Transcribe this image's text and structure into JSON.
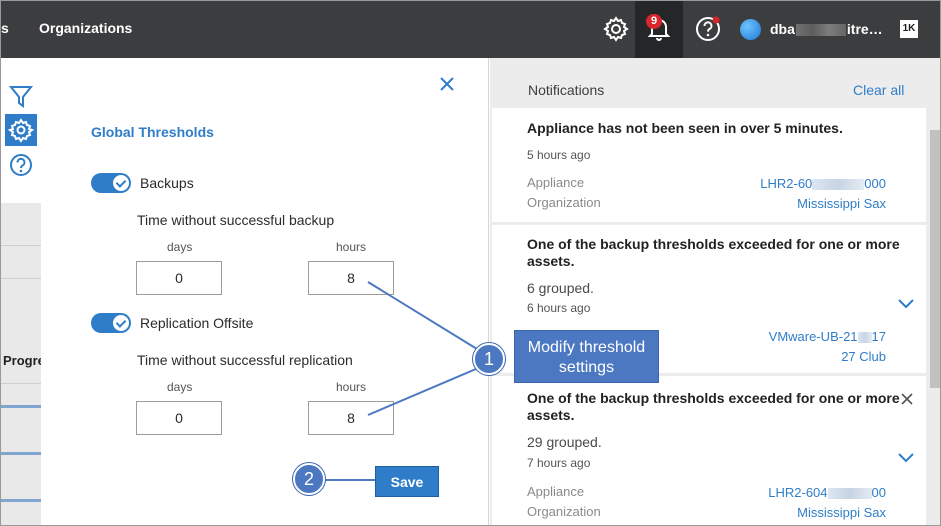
{
  "topbar": {
    "partial_nav": "s",
    "nav_item": "Organizations",
    "notification_badge": "9",
    "user_name_start": "dba",
    "user_name_end": "itre…",
    "logo_text": "1K"
  },
  "left_rail": {
    "partial_column_header": "Progre"
  },
  "global_thresholds": {
    "title": "Global Thresholds",
    "backups": {
      "toggle_label": "Backups",
      "enabled": true,
      "subtitle": "Time without successful backup",
      "days_label": "days",
      "hours_label": "hours",
      "days_value": "0",
      "hours_value": "8"
    },
    "replication": {
      "toggle_label": "Replication Offsite",
      "enabled": true,
      "subtitle": "Time without successful replication",
      "days_label": "days",
      "hours_label": "hours",
      "days_value": "0",
      "hours_value": "8"
    },
    "save_label": "Save"
  },
  "notifications": {
    "title": "Notifications",
    "clear_all": "Clear all",
    "items": [
      {
        "title": "Appliance has not been seen in over 5 minutes.",
        "time": "5 hours ago",
        "appliance_key": "Appliance",
        "appliance_start": "LHR2-60",
        "appliance_end": "000",
        "organization_key": "Organization",
        "organization_value": "Mississippi Sax"
      },
      {
        "title": "One of the backup thresholds exceeded for one or more assets.",
        "grouped": "6 grouped.",
        "time": "6 hours ago",
        "asset_start": "VMware-UB-21",
        "asset_end": "17",
        "organization_value": "27 Club"
      },
      {
        "title": "One of the backup thresholds exceeded for one or more assets.",
        "grouped": "29 grouped.",
        "time": "7 hours ago",
        "appliance_key": "Appliance",
        "appliance_start": "LHR2-604",
        "appliance_end": "00",
        "organization_key": "Organization",
        "organization_value": "Mississippi Sax"
      }
    ]
  },
  "annotations": {
    "callout_text": "Modify threshold settings",
    "step1": "1",
    "step2": "2"
  },
  "colors": {
    "accent": "#2f7dc9",
    "topbar": "#3c3d3f",
    "badge": "#d8262d",
    "annotation": "#4c78c2"
  }
}
